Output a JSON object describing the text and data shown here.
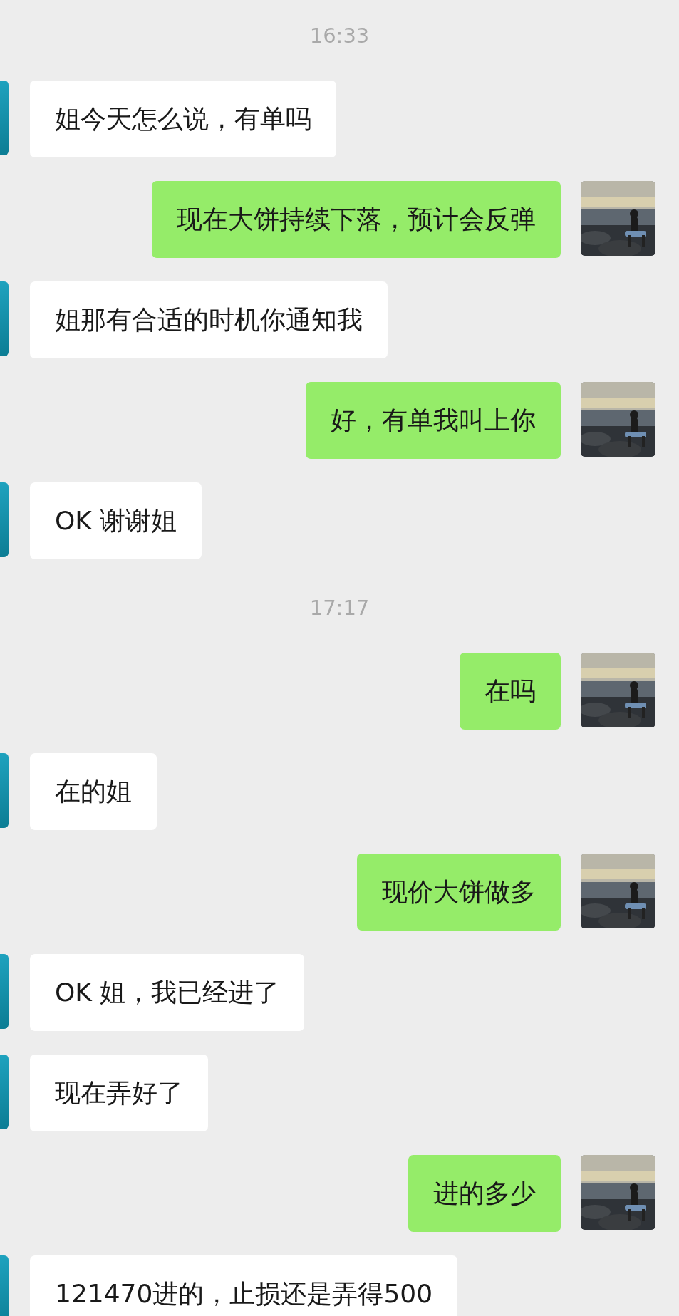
{
  "messages": [
    {
      "kind": "time",
      "text": "16:33"
    },
    {
      "kind": "received",
      "text": "姐今天怎么说，有单吗"
    },
    {
      "kind": "sent",
      "text": "现在大饼持续下落，预计会反弹"
    },
    {
      "kind": "received",
      "text": "姐那有合适的时机你通知我"
    },
    {
      "kind": "sent",
      "text": "好，有单我叫上你"
    },
    {
      "kind": "received",
      "text": "OK 谢谢姐"
    },
    {
      "kind": "time",
      "text": "17:17"
    },
    {
      "kind": "sent",
      "text": "在吗"
    },
    {
      "kind": "received",
      "text": "在的姐"
    },
    {
      "kind": "sent",
      "text": "现价大饼做多"
    },
    {
      "kind": "received",
      "text": "OK 姐，我已经进了"
    },
    {
      "kind": "received",
      "text": "现在弄好了"
    },
    {
      "kind": "sent",
      "text": "进的多少"
    },
    {
      "kind": "received",
      "text": "121470进的，止损还是弄得500"
    }
  ]
}
